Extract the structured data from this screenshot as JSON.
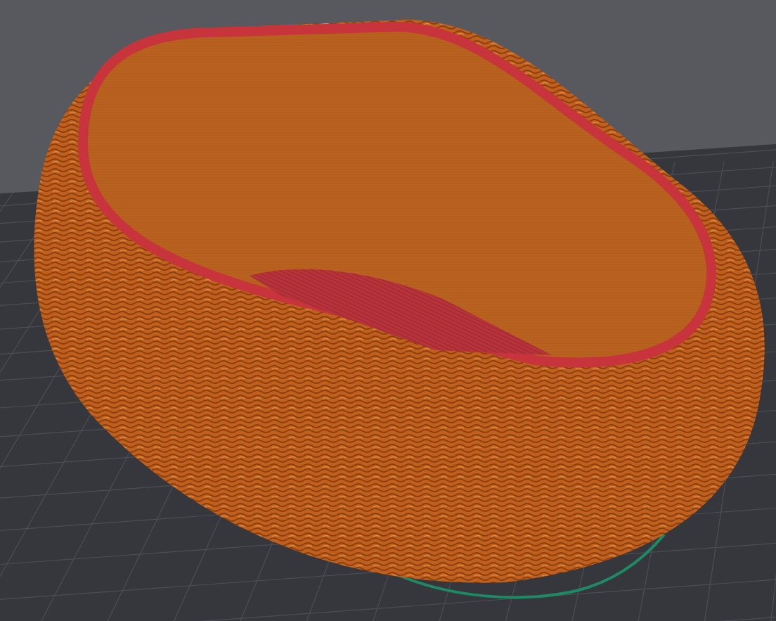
{
  "viewport": {
    "kind": "gcode-preview"
  }
}
